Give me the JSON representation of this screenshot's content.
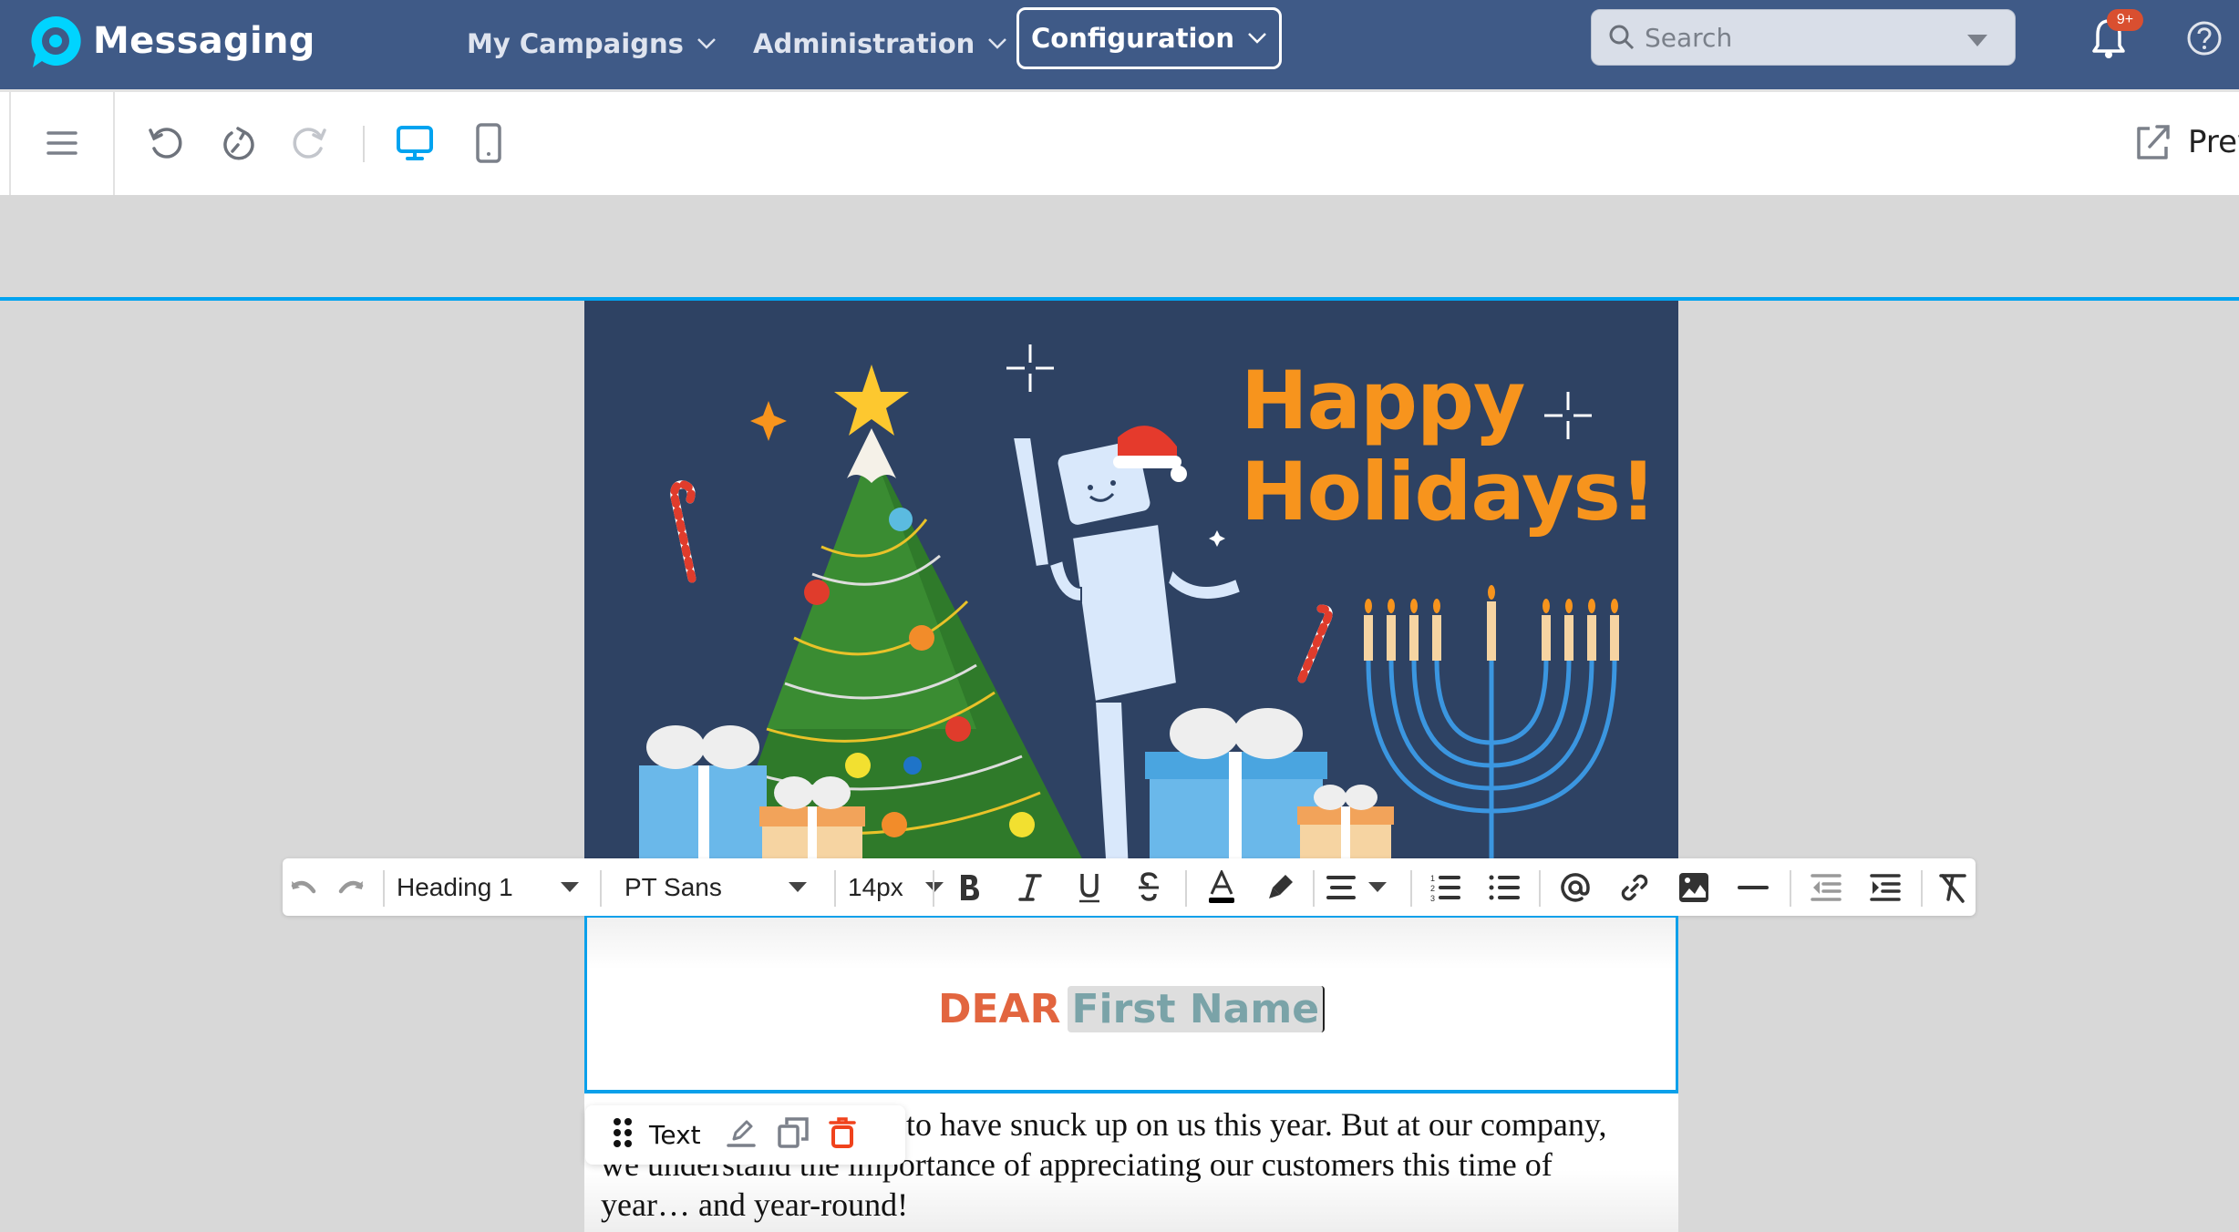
{
  "app": {
    "name": "Messaging",
    "brand_color": "#00d4ff",
    "header_bg": "#3f5a87"
  },
  "nav": {
    "items": [
      {
        "label": "My Campaigns"
      },
      {
        "label": "Administration"
      },
      {
        "label": "Configuration",
        "active": true
      }
    ]
  },
  "search": {
    "placeholder": "Search",
    "value": ""
  },
  "notifications": {
    "badge": "9+",
    "icon": "bell-icon"
  },
  "help": {
    "icon": "help-icon"
  },
  "editor_toolbar": {
    "buttons": [
      "menu-icon",
      "undo-icon",
      "restore-icon",
      "redo-icon",
      "desktop-view-icon",
      "mobile-view-icon"
    ],
    "active_view": "desktop",
    "preview_label": "Prev"
  },
  "text_toolbar": {
    "block_format": "Heading 1",
    "font_family": "PT Sans",
    "font_size": "14px",
    "buttons": [
      "undo",
      "redo",
      "bold",
      "italic",
      "underline",
      "strikethrough",
      "font-color",
      "highlight",
      "align",
      "ordered-list",
      "bullet-list",
      "mention",
      "link",
      "image",
      "horizontal-rule",
      "outdent",
      "indent",
      "clear-formatting"
    ]
  },
  "email": {
    "banner": {
      "headline_line1": "Happy",
      "headline_line2": "Holidays!",
      "bg_color": "#2e4263",
      "headline_color": "#f7941d"
    },
    "greeting": {
      "prefix": "DEAR",
      "merge_field": "First Name",
      "prefix_color": "#e2653f",
      "merge_color": "#7aa3a8"
    },
    "body_visible_lines": [
      "to have snuck up on us this year. But at our company,",
      "we understand the importance of appreciating our customers this time of",
      "year… and year-round!"
    ]
  },
  "block_tool": {
    "label": "Text",
    "actions": [
      "drag-handle",
      "edit",
      "duplicate",
      "delete"
    ],
    "delete_color": "#f0421c"
  },
  "accent_color": "#00a3f0"
}
